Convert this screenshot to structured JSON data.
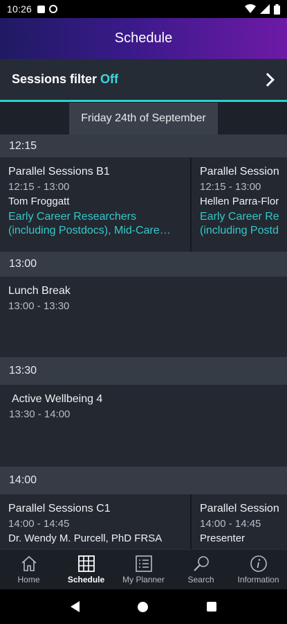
{
  "status_bar": {
    "time": "10:26"
  },
  "header": {
    "title": "Schedule"
  },
  "filter": {
    "label": "Sessions filter",
    "value": "Off"
  },
  "date": "Friday 24th of September",
  "blocks": [
    {
      "time": "12:15",
      "sessions": [
        {
          "title": "Parallel Sessions B1",
          "time": "12:15 - 13:00",
          "speaker": "Tom Froggatt",
          "tag_line1": "Early Career Researchers",
          "tag_line2": "(including Postdocs), Mid-Care…"
        },
        {
          "title": "Parallel Sessions",
          "time": "12:15 - 13:00",
          "speaker": "Hellen Parra-Flor",
          "tag_line1": "Early Career Resea",
          "tag_line2": "(including Postdoc"
        }
      ]
    },
    {
      "time": "13:00",
      "sessions": [
        {
          "title": "Lunch Break",
          "time": "13:00 - 13:30"
        }
      ]
    },
    {
      "time": "13:30",
      "sessions": [
        {
          "title": "Active Wellbeing 4",
          "time": "13:30 - 14:00"
        }
      ]
    },
    {
      "time": "14:00",
      "sessions": [
        {
          "title": "Parallel Sessions C1",
          "time": "14:00 - 14:45",
          "speaker": "Dr. Wendy M. Purcell, PhD FRSA"
        },
        {
          "title": "Parallel Sessions",
          "time": "14:00 - 14:45",
          "speaker": "Presenter"
        }
      ]
    }
  ],
  "bottom_nav": [
    {
      "label": "Home",
      "icon": "home-icon"
    },
    {
      "label": "Schedule",
      "icon": "schedule-grid-icon",
      "active": true
    },
    {
      "label": "My Planner",
      "icon": "planner-list-icon"
    },
    {
      "label": "Search",
      "icon": "search-icon"
    },
    {
      "label": "Information",
      "icon": "info-icon"
    }
  ],
  "colors": {
    "accent": "#35c9c9",
    "header_start": "#1f1a63",
    "header_end": "#6d1aa6"
  }
}
